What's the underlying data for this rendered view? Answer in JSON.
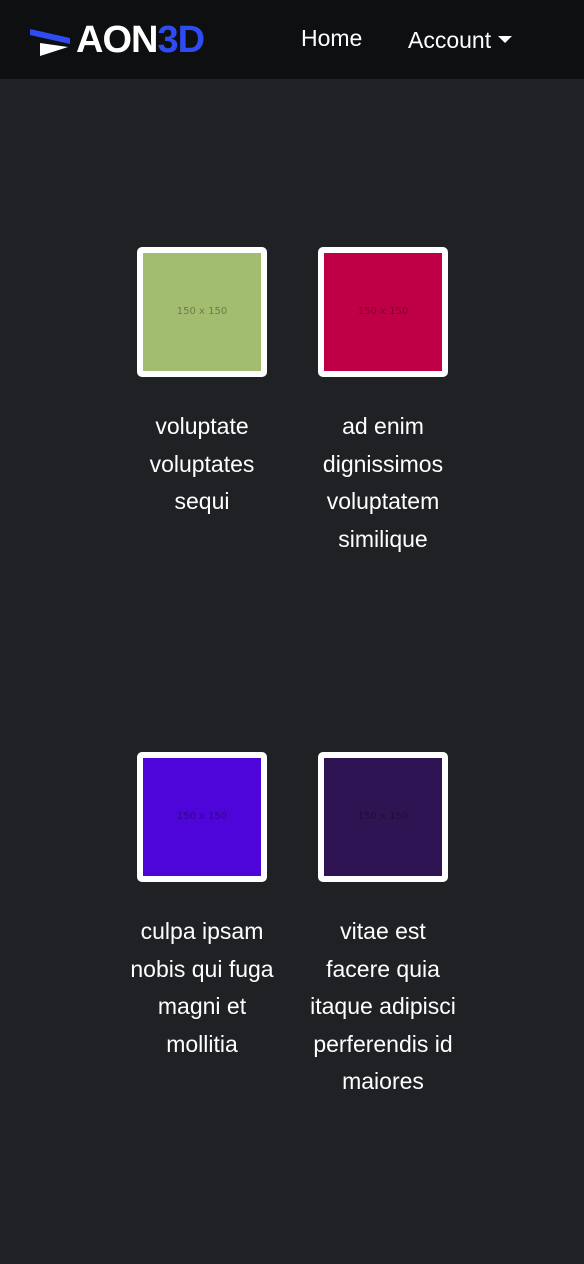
{
  "navbar": {
    "brand": {
      "part1": "AON",
      "part2": "3D",
      "accent_color": "#2f4cf2"
    },
    "links": {
      "home": "Home",
      "account": "Account"
    }
  },
  "items": [
    {
      "title": "voluptate voluptates sequi",
      "thumb_label": "150 x 150",
      "color": "#a2bd6f"
    },
    {
      "title": "ad enim dignissimos voluptatem similique",
      "thumb_label": "150 x 150",
      "color": "#c00046"
    },
    {
      "title": "culpa ipsam nobis qui fuga magni et mollitia",
      "thumb_label": "150 x 150",
      "color": "#4d05da"
    },
    {
      "title": "vitae est facere quia itaque adipisci perferendis id maiores",
      "thumb_label": "150 x 150",
      "color": "#2f1453"
    }
  ]
}
